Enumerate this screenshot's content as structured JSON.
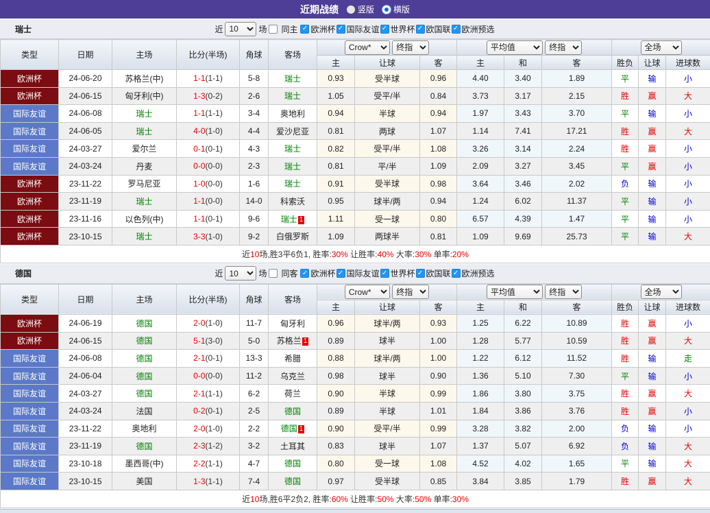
{
  "topbar": {
    "title": "近期战绩",
    "radios": [
      {
        "label": "竖版",
        "selected": false
      },
      {
        "label": "横版",
        "selected": true
      }
    ]
  },
  "filter": {
    "prefix": "近",
    "count": "10",
    "suffix": "场",
    "leagues": [
      "欧洲杯",
      "国际友谊",
      "世界杯",
      "欧国联",
      "欧洲预选"
    ]
  },
  "dropdowns": {
    "company": "Crow*",
    "final_a": "终指",
    "average": "平均值",
    "final_b": "终指",
    "full_match": "全场"
  },
  "columns": {
    "main": [
      "类型",
      "日期",
      "主场",
      "比分(半场)",
      "角球",
      "客场"
    ],
    "odds": [
      "主",
      "让球",
      "客"
    ],
    "avg": [
      "主",
      "和",
      "客"
    ],
    "result": [
      "胜负",
      "让球",
      "进球数"
    ]
  },
  "colors": {
    "topbar": "#4e3e97",
    "league_euro": "#7b0c11",
    "league_friendly": "#5b79c8",
    "focal_team": "#008000",
    "score_red": "#e60000",
    "result_red": "#e60000",
    "result_green": "#008000",
    "result_blue": "#0000d0",
    "checkbox_blue": "#2296f3"
  },
  "sections": [
    {
      "team": "瑞士",
      "same_label": "同主",
      "rows": [
        {
          "league": "欧洲杯",
          "date": "24-06-20",
          "home": "苏格兰(中)",
          "home_focal": false,
          "score": "1-1",
          "half": "(1-1)",
          "corners": "5-8",
          "away": "瑞士",
          "away_focal": true,
          "badge": "",
          "odds": [
            "0.93",
            "受半球",
            "0.96"
          ],
          "avg": [
            "4.40",
            "3.40",
            "1.89"
          ],
          "result": [
            "平",
            "输",
            "小"
          ]
        },
        {
          "league": "欧洲杯",
          "date": "24-06-15",
          "home": "匈牙利(中)",
          "home_focal": false,
          "score": "1-3",
          "half": "(0-2)",
          "corners": "2-6",
          "away": "瑞士",
          "away_focal": true,
          "badge": "",
          "odds": [
            "1.05",
            "受平/半",
            "0.84"
          ],
          "avg": [
            "3.73",
            "3.17",
            "2.15"
          ],
          "result": [
            "胜",
            "赢",
            "大"
          ]
        },
        {
          "league": "国际友谊",
          "date": "24-06-08",
          "home": "瑞士",
          "home_focal": true,
          "score": "1-1",
          "half": "(1-1)",
          "corners": "3-4",
          "away": "奥地利",
          "away_focal": false,
          "badge": "",
          "odds": [
            "0.94",
            "半球",
            "0.94"
          ],
          "avg": [
            "1.97",
            "3.43",
            "3.70"
          ],
          "result": [
            "平",
            "输",
            "小"
          ]
        },
        {
          "league": "国际友谊",
          "date": "24-06-05",
          "home": "瑞士",
          "home_focal": true,
          "score": "4-0",
          "half": "(1-0)",
          "corners": "4-4",
          "away": "爱沙尼亚",
          "away_focal": false,
          "badge": "",
          "odds": [
            "0.81",
            "两球",
            "1.07"
          ],
          "avg": [
            "1.14",
            "7.41",
            "17.21"
          ],
          "result": [
            "胜",
            "赢",
            "大"
          ]
        },
        {
          "league": "国际友谊",
          "date": "24-03-27",
          "home": "爱尔兰",
          "home_focal": false,
          "score": "0-1",
          "half": "(0-1)",
          "corners": "4-3",
          "away": "瑞士",
          "away_focal": true,
          "badge": "",
          "odds": [
            "0.82",
            "受平/半",
            "1.08"
          ],
          "avg": [
            "3.26",
            "3.14",
            "2.24"
          ],
          "result": [
            "胜",
            "赢",
            "小"
          ]
        },
        {
          "league": "国际友谊",
          "date": "24-03-24",
          "home": "丹麦",
          "home_focal": false,
          "score": "0-0",
          "half": "(0-0)",
          "corners": "2-3",
          "away": "瑞士",
          "away_focal": true,
          "badge": "",
          "odds": [
            "0.81",
            "平/半",
            "1.09"
          ],
          "avg": [
            "2.09",
            "3.27",
            "3.45"
          ],
          "result": [
            "平",
            "赢",
            "小"
          ]
        },
        {
          "league": "欧洲杯",
          "date": "23-11-22",
          "home": "罗马尼亚",
          "home_focal": false,
          "score": "1-0",
          "half": "(0-0)",
          "corners": "1-6",
          "away": "瑞士",
          "away_focal": true,
          "badge": "",
          "odds": [
            "0.91",
            "受半球",
            "0.98"
          ],
          "avg": [
            "3.64",
            "3.46",
            "2.02"
          ],
          "result": [
            "负",
            "输",
            "小"
          ]
        },
        {
          "league": "欧洲杯",
          "date": "23-11-19",
          "home": "瑞士",
          "home_focal": true,
          "score": "1-1",
          "half": "(0-0)",
          "corners": "14-0",
          "away": "科索沃",
          "away_focal": false,
          "badge": "",
          "odds": [
            "0.95",
            "球半/两",
            "0.94"
          ],
          "avg": [
            "1.24",
            "6.02",
            "11.37"
          ],
          "result": [
            "平",
            "输",
            "小"
          ]
        },
        {
          "league": "欧洲杯",
          "date": "23-11-16",
          "home": "以色列(中)",
          "home_focal": false,
          "score": "1-1",
          "half": "(0-1)",
          "corners": "9-6",
          "away": "瑞士",
          "away_focal": true,
          "badge": "1",
          "odds": [
            "1.11",
            "受一球",
            "0.80"
          ],
          "avg": [
            "6.57",
            "4.39",
            "1.47"
          ],
          "result": [
            "平",
            "输",
            "小"
          ]
        },
        {
          "league": "欧洲杯",
          "date": "23-10-15",
          "home": "瑞士",
          "home_focal": true,
          "score": "3-3",
          "half": "(1-0)",
          "corners": "9-2",
          "away": "白俄罗斯",
          "away_focal": false,
          "badge": "",
          "odds": [
            "1.09",
            "两球半",
            "0.81"
          ],
          "avg": [
            "1.09",
            "9.69",
            "25.73"
          ],
          "result": [
            "平",
            "输",
            "大"
          ]
        }
      ],
      "summary": [
        {
          "text": "近",
          "red": false
        },
        {
          "text": "10",
          "red": true
        },
        {
          "text": "场,胜3平6负1, 胜率:",
          "red": false
        },
        {
          "text": "30%",
          "red": true
        },
        {
          "text": " 让胜率:",
          "red": false
        },
        {
          "text": "40%",
          "red": true
        },
        {
          "text": " 大率:",
          "red": false
        },
        {
          "text": "30%",
          "red": true
        },
        {
          "text": " 单率:",
          "red": false
        },
        {
          "text": "20%",
          "red": true
        }
      ]
    },
    {
      "team": "德国",
      "same_label": "同客",
      "rows": [
        {
          "league": "欧洲杯",
          "date": "24-06-19",
          "home": "德国",
          "home_focal": true,
          "score": "2-0",
          "half": "(1-0)",
          "corners": "11-7",
          "away": "匈牙利",
          "away_focal": false,
          "badge": "",
          "odds": [
            "0.96",
            "球半/两",
            "0.93"
          ],
          "avg": [
            "1.25",
            "6.22",
            "10.89"
          ],
          "result": [
            "胜",
            "赢",
            "小"
          ]
        },
        {
          "league": "欧洲杯",
          "date": "24-06-15",
          "home": "德国",
          "home_focal": true,
          "score": "5-1",
          "half": "(3-0)",
          "corners": "5-0",
          "away": "苏格兰",
          "away_focal": false,
          "badge": "1",
          "odds": [
            "0.89",
            "球半",
            "1.00"
          ],
          "avg": [
            "1.28",
            "5.77",
            "10.59"
          ],
          "result": [
            "胜",
            "赢",
            "大"
          ]
        },
        {
          "league": "国际友谊",
          "date": "24-06-08",
          "home": "德国",
          "home_focal": true,
          "score": "2-1",
          "half": "(0-1)",
          "corners": "13-3",
          "away": "希腊",
          "away_focal": false,
          "badge": "",
          "odds": [
            "0.88",
            "球半/两",
            "1.00"
          ],
          "avg": [
            "1.22",
            "6.12",
            "11.52"
          ],
          "result": [
            "胜",
            "输",
            "走"
          ]
        },
        {
          "league": "国际友谊",
          "date": "24-06-04",
          "home": "德国",
          "home_focal": true,
          "score": "0-0",
          "half": "(0-0)",
          "corners": "11-2",
          "away": "乌克兰",
          "away_focal": false,
          "badge": "",
          "odds": [
            "0.98",
            "球半",
            "0.90"
          ],
          "avg": [
            "1.36",
            "5.10",
            "7.30"
          ],
          "result": [
            "平",
            "输",
            "小"
          ]
        },
        {
          "league": "国际友谊",
          "date": "24-03-27",
          "home": "德国",
          "home_focal": true,
          "score": "2-1",
          "half": "(1-1)",
          "corners": "6-2",
          "away": "荷兰",
          "away_focal": false,
          "badge": "",
          "odds": [
            "0.90",
            "半球",
            "0.99"
          ],
          "avg": [
            "1.86",
            "3.80",
            "3.75"
          ],
          "result": [
            "胜",
            "赢",
            "大"
          ]
        },
        {
          "league": "国际友谊",
          "date": "24-03-24",
          "home": "法国",
          "home_focal": false,
          "score": "0-2",
          "half": "(0-1)",
          "corners": "2-5",
          "away": "德国",
          "away_focal": true,
          "badge": "",
          "odds": [
            "0.89",
            "半球",
            "1.01"
          ],
          "avg": [
            "1.84",
            "3.86",
            "3.76"
          ],
          "result": [
            "胜",
            "赢",
            "小"
          ]
        },
        {
          "league": "国际友谊",
          "date": "23-11-22",
          "home": "奥地利",
          "home_focal": false,
          "score": "2-0",
          "half": "(1-0)",
          "corners": "2-2",
          "away": "德国",
          "away_focal": true,
          "badge": "1",
          "odds": [
            "0.90",
            "受平/半",
            "0.99"
          ],
          "avg": [
            "3.28",
            "3.82",
            "2.00"
          ],
          "result": [
            "负",
            "输",
            "小"
          ]
        },
        {
          "league": "国际友谊",
          "date": "23-11-19",
          "home": "德国",
          "home_focal": true,
          "score": "2-3",
          "half": "(1-2)",
          "corners": "3-2",
          "away": "土耳其",
          "away_focal": false,
          "badge": "",
          "odds": [
            "0.83",
            "球半",
            "1.07"
          ],
          "avg": [
            "1.37",
            "5.07",
            "6.92"
          ],
          "result": [
            "负",
            "输",
            "大"
          ]
        },
        {
          "league": "国际友谊",
          "date": "23-10-18",
          "home": "墨西哥(中)",
          "home_focal": false,
          "score": "2-2",
          "half": "(1-1)",
          "corners": "4-7",
          "away": "德国",
          "away_focal": true,
          "badge": "",
          "odds": [
            "0.80",
            "受一球",
            "1.08"
          ],
          "avg": [
            "4.52",
            "4.02",
            "1.65"
          ],
          "result": [
            "平",
            "输",
            "大"
          ]
        },
        {
          "league": "国际友谊",
          "date": "23-10-15",
          "home": "美国",
          "home_focal": false,
          "score": "1-3",
          "half": "(1-1)",
          "corners": "7-4",
          "away": "德国",
          "away_focal": true,
          "badge": "",
          "odds": [
            "0.97",
            "受半球",
            "0.85"
          ],
          "avg": [
            "3.84",
            "3.85",
            "1.79"
          ],
          "result": [
            "胜",
            "赢",
            "大"
          ]
        }
      ],
      "summary": [
        {
          "text": "近",
          "red": false
        },
        {
          "text": "10",
          "red": true
        },
        {
          "text": "场,胜6平2负2, 胜率:",
          "red": false
        },
        {
          "text": "60%",
          "red": true
        },
        {
          "text": " 让胜率:",
          "red": false
        },
        {
          "text": "50%",
          "red": true
        },
        {
          "text": " 大率:",
          "red": false
        },
        {
          "text": "50%",
          "red": true
        },
        {
          "text": " 单率:",
          "red": false
        },
        {
          "text": "30%",
          "red": true
        }
      ]
    }
  ]
}
